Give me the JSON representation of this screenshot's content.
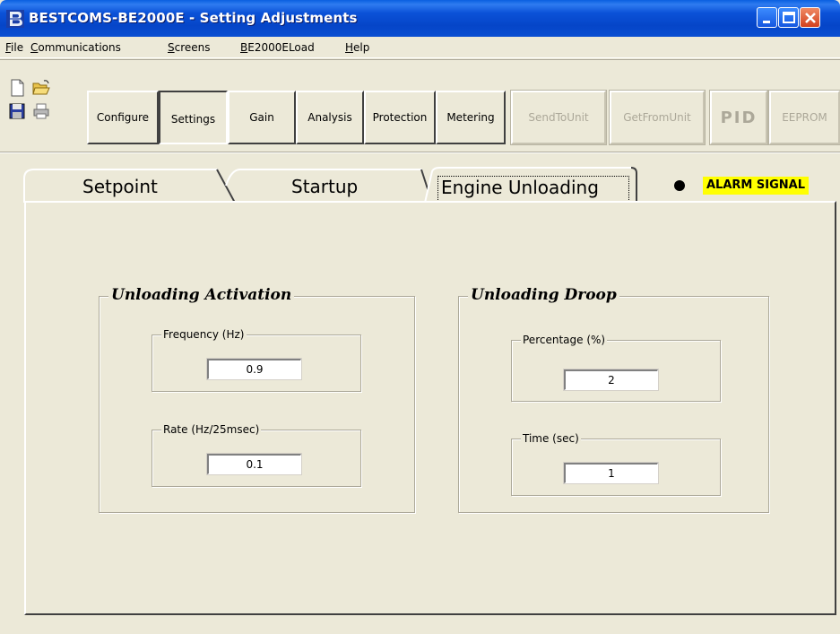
{
  "window": {
    "title": "BESTCOMS-BE2000E - Setting Adjustments"
  },
  "menu": {
    "items": [
      {
        "pre": "",
        "acc": "F",
        "post": "ile"
      },
      {
        "pre": "",
        "acc": "C",
        "post": "ommunications"
      },
      {
        "pre": "",
        "acc": "S",
        "post": "creens"
      },
      {
        "pre": "",
        "acc": "B",
        "post": "E2000ELoad"
      },
      {
        "pre": "",
        "acc": "H",
        "post": "elp"
      }
    ]
  },
  "toolbar": {
    "icons": [
      "new-file-icon",
      "open-folder-icon",
      "save-disk-icon",
      "print-icon"
    ],
    "buttons": [
      {
        "label": "Configure",
        "state": "normal"
      },
      {
        "label": "Settings",
        "state": "pressed"
      },
      {
        "label": "Gain",
        "state": "normal"
      },
      {
        "label": "Analysis",
        "state": "normal"
      },
      {
        "label": "Protection",
        "state": "normal"
      },
      {
        "label": "Metering",
        "state": "normal"
      },
      {
        "label": "SendToUnit",
        "state": "disabled"
      },
      {
        "label": "GetFromUnit",
        "state": "disabled"
      },
      {
        "label": "PID",
        "state": "disabled"
      },
      {
        "label": "EEPROM",
        "state": "disabled"
      }
    ]
  },
  "tabs": {
    "items": [
      {
        "label": "Setpoint",
        "active": false
      },
      {
        "label": "Startup",
        "active": false
      },
      {
        "label": "Engine Unloading",
        "active": true
      }
    ],
    "alarm_label": "ALARM SIGNAL",
    "alarm_color": "#ffff00"
  },
  "unloading_activation": {
    "title": "Unloading Activation",
    "frequency": {
      "label": "Frequency (Hz)",
      "value": "0.9"
    },
    "rate": {
      "label": "Rate (Hz/25msec)",
      "value": "0.1"
    }
  },
  "unloading_droop": {
    "title": "Unloading Droop",
    "percentage": {
      "label": "Percentage (%)",
      "value": "2"
    },
    "time": {
      "label": "Time (sec)",
      "value": "1"
    }
  }
}
